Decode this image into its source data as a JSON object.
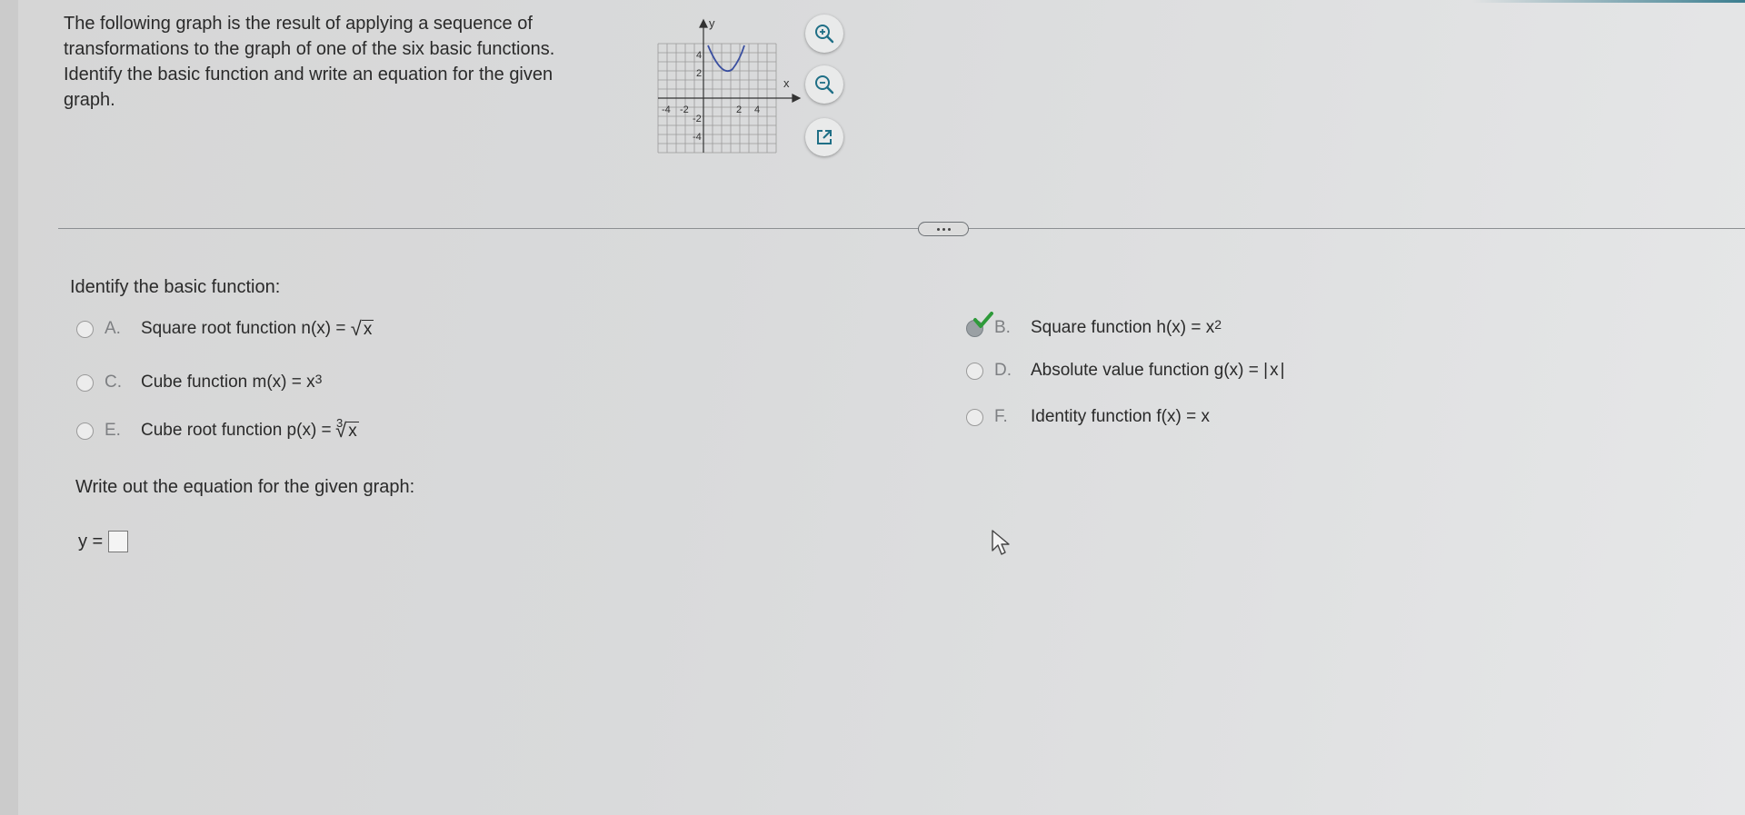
{
  "prompt": {
    "lines": [
      "The following graph is the result of applying a sequence of",
      "transformations to the graph of one of the six basic functions.",
      "Identify the basic function and write an equation for the given",
      "graph."
    ]
  },
  "graph": {
    "x_axis_label": "x",
    "y_axis_label": "y",
    "x_ticks": [
      "-4",
      "-2",
      "2",
      "4"
    ],
    "y_ticks": [
      "4",
      "2",
      "-2",
      "-4"
    ],
    "curve_color": "#3a4fa0"
  },
  "tools": {
    "zoom_in_icon": "zoom-in-icon",
    "zoom_out_icon": "zoom-out-icon",
    "popout_icon": "external-link-icon",
    "accent_color": "#1f6f86"
  },
  "question1": {
    "label": "Identify the basic function:",
    "options": {
      "A": {
        "letter": "A.",
        "text": "Square root function",
        "lhs": "n(x) =",
        "rad": "x"
      },
      "B": {
        "letter": "B.",
        "text": "Square function",
        "lhs": "h(x) = x",
        "exp": "2",
        "selected": true
      },
      "C": {
        "letter": "C.",
        "text": "Cube function",
        "lhs": "m(x) = x",
        "exp": "3"
      },
      "D": {
        "letter": "D.",
        "text": "Absolute value function",
        "lhs": "g(x) =",
        "abs": "x"
      },
      "E": {
        "letter": "E.",
        "text": "Cube root function",
        "lhs": "p(x) =",
        "index": "3",
        "rad": "x"
      },
      "F": {
        "letter": "F.",
        "text": "Identity function",
        "lhs": "f(x) = x"
      }
    }
  },
  "question2": {
    "label": "Write out the equation for the given graph:",
    "answer_prefix": "y ="
  },
  "colors": {
    "check": "#2e9a3a"
  }
}
